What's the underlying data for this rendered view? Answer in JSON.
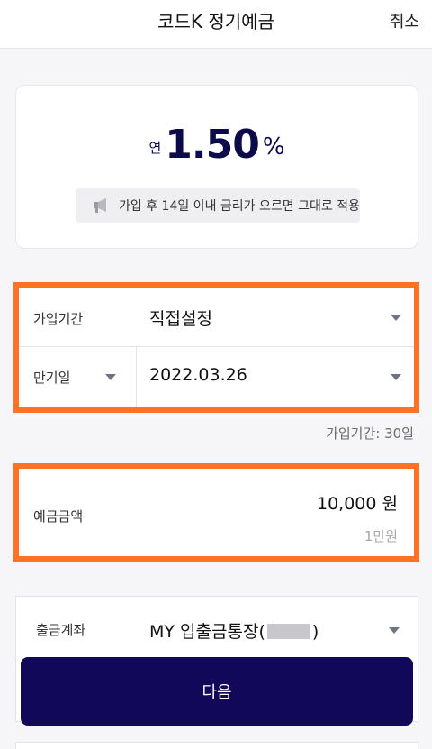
{
  "header": {
    "title": "코드K 정기예금",
    "cancel_label": "취소"
  },
  "rate": {
    "prefix": "연",
    "value": "1.50",
    "unit": "%",
    "notice": "가입 후 14일 이내 금리가 오르면 그대로 적용",
    "notice_icon": "megaphone-icon"
  },
  "period": {
    "label": "가입기간",
    "value": "직접설정",
    "maturity_label": "만기일",
    "maturity_date": "2022.03.26",
    "note": "가입기간: 30일"
  },
  "amount": {
    "label": "예금금액",
    "value": "10,000 원",
    "sub": "1만원"
  },
  "account": {
    "label": "출금계좌",
    "value_prefix": "MY 입출금통장(",
    "value_suffix": ")"
  },
  "actions": {
    "next_label": "다음"
  },
  "colors": {
    "highlight": "#ff7127",
    "primary": "#11085a",
    "rate_text": "#0c0a4a"
  }
}
